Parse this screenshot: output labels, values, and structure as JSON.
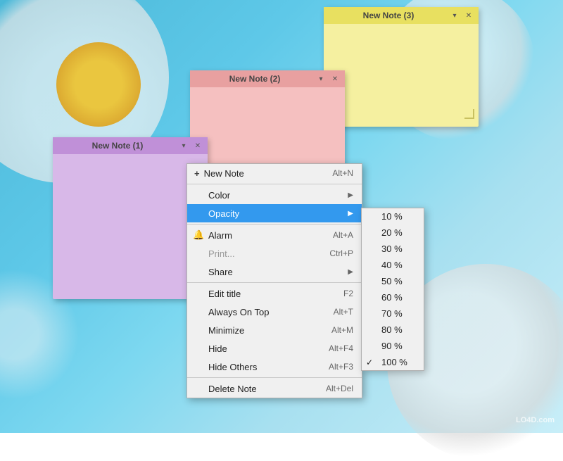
{
  "background": {
    "color_start": "#4ab8d8",
    "color_end": "#c8eef8"
  },
  "notes": {
    "note1": {
      "title": "New Note (1)",
      "color_header": "#c090d8",
      "color_body": "#d8b8e8",
      "controls": [
        "▾",
        "✕"
      ]
    },
    "note2": {
      "title": "New Note (2)",
      "color_header": "#e8a0a0",
      "color_body": "#f5c0c0",
      "controls": [
        "▾",
        "✕"
      ]
    },
    "note3": {
      "title": "New Note (3)",
      "color_header": "#e8e060",
      "color_body": "#f5f0a0",
      "controls": [
        "▾",
        "✕"
      ]
    }
  },
  "context_menu": {
    "items": [
      {
        "id": "new-note",
        "label": "New Note",
        "shortcut": "Alt+N",
        "icon": "+",
        "type": "new",
        "has_arrow": false,
        "disabled": false
      },
      {
        "id": "separator1",
        "type": "separator"
      },
      {
        "id": "color",
        "label": "Color",
        "shortcut": "",
        "has_arrow": true,
        "disabled": false
      },
      {
        "id": "opacity",
        "label": "Opacity",
        "shortcut": "",
        "has_arrow": true,
        "disabled": false,
        "hovered": true
      },
      {
        "id": "separator2",
        "type": "separator"
      },
      {
        "id": "alarm",
        "label": "Alarm",
        "shortcut": "Alt+A",
        "icon": "🔔",
        "has_arrow": false,
        "disabled": false
      },
      {
        "id": "print",
        "label": "Print...",
        "shortcut": "Ctrl+P",
        "has_arrow": false,
        "disabled": true
      },
      {
        "id": "share",
        "label": "Share",
        "shortcut": "",
        "has_arrow": true,
        "disabled": false
      },
      {
        "id": "separator3",
        "type": "separator"
      },
      {
        "id": "edit-title",
        "label": "Edit title",
        "shortcut": "F2",
        "has_arrow": false,
        "disabled": false
      },
      {
        "id": "always-on-top",
        "label": "Always On Top",
        "shortcut": "Alt+T",
        "has_arrow": false,
        "disabled": false
      },
      {
        "id": "minimize",
        "label": "Minimize",
        "shortcut": "Alt+M",
        "has_arrow": false,
        "disabled": false
      },
      {
        "id": "hide",
        "label": "Hide",
        "shortcut": "Alt+F4",
        "has_arrow": false,
        "disabled": false
      },
      {
        "id": "hide-others",
        "label": "Hide Others",
        "shortcut": "Alt+F3",
        "has_arrow": false,
        "disabled": false
      },
      {
        "id": "separator4",
        "type": "separator"
      },
      {
        "id": "delete-note",
        "label": "Delete Note",
        "shortcut": "Alt+Del",
        "has_arrow": false,
        "disabled": false
      }
    ]
  },
  "opacity_submenu": {
    "items": [
      {
        "id": "10",
        "label": "10 %",
        "checked": false
      },
      {
        "id": "20",
        "label": "20 %",
        "checked": false
      },
      {
        "id": "30",
        "label": "30 %",
        "checked": false
      },
      {
        "id": "40",
        "label": "40 %",
        "checked": false
      },
      {
        "id": "50",
        "label": "50 %",
        "checked": false
      },
      {
        "id": "60",
        "label": "60 %",
        "checked": false
      },
      {
        "id": "70",
        "label": "70 %",
        "checked": false
      },
      {
        "id": "80",
        "label": "80 %",
        "checked": false
      },
      {
        "id": "90",
        "label": "90 %",
        "checked": false
      },
      {
        "id": "100",
        "label": "100 %",
        "checked": true
      }
    ]
  },
  "watermark": {
    "text": "LO4D.com"
  }
}
